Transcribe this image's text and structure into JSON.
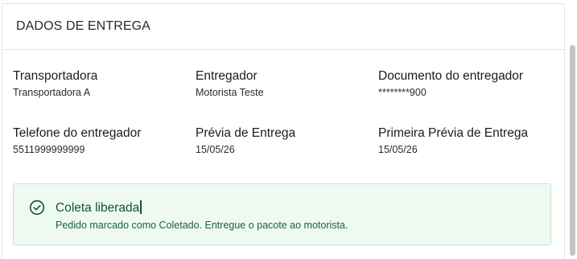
{
  "section": {
    "title": "DADOS DE ENTREGA"
  },
  "fields": [
    {
      "label": "Transportadora",
      "value": "Transportadora A"
    },
    {
      "label": "Entregador",
      "value": "Motorista Teste"
    },
    {
      "label": "Documento do entregador",
      "value": "********900"
    },
    {
      "label": "Telefone do entregador",
      "value": "5511999999999"
    },
    {
      "label": "Prévia de Entrega",
      "value": "15/05/26"
    },
    {
      "label": "Primeira Prévia de Entrega",
      "value": "15/05/26"
    }
  ],
  "alert": {
    "icon": "check-circle-icon",
    "title": "Coleta liberada",
    "message": "Pedido marcado como Coletado. Entregue o pacote ao motorista.",
    "colors": {
      "background": "#eefaf1",
      "border": "#bfe7cb",
      "text": "#166534"
    }
  }
}
